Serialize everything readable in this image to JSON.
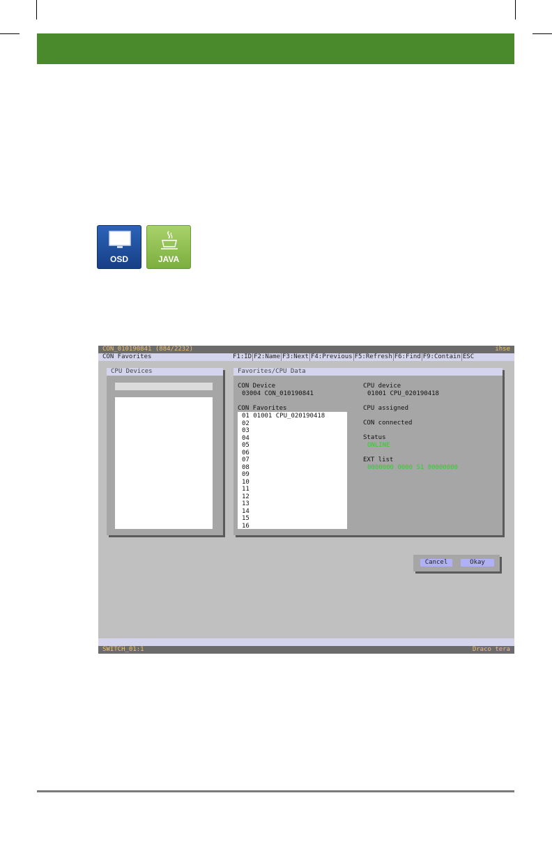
{
  "badges": {
    "osd": "OSD",
    "java": "JAVA"
  },
  "osd": {
    "title": "CON_010190841 (884/2232)",
    "brand": "ihse",
    "menu_title": "CON Favorites",
    "fkeys": [
      "F1:ID",
      "F2:Name",
      "F3:Next",
      "F4:Previous",
      "F5:Refresh",
      "F6:Find",
      "F9:Contain",
      "ESC"
    ],
    "cpu_panel": {
      "title": "CPU Devices"
    },
    "fav_panel": {
      "title": "Favorites/CPU Data",
      "con_device_label": "CON Device",
      "con_device_value": "03004 CON_010190841",
      "con_favorites_label": "CON Favorites",
      "favorites": [
        "01 01001 CPU_020190418",
        "02",
        "03",
        "04",
        "05",
        "06",
        "07",
        "08",
        "09",
        "10",
        "11",
        "12",
        "13",
        "14",
        "15",
        "16"
      ],
      "cpu_device_label": "CPU device",
      "cpu_device_value": "01001 CPU_020190418",
      "cpu_assigned_label": "CPU assigned",
      "con_connected_label": "CON connected",
      "status_label": "Status",
      "status_value": "ONLINE",
      "ext_list_label": "EXT list",
      "ext_list_value": "0000000 0000 S1 00000000"
    },
    "buttons": {
      "cancel": "Cancel",
      "okay": "Okay"
    },
    "status_left": "SWITCH_01:1",
    "status_right": "Draco tera"
  },
  "colors": {
    "header_green": "#4a8a2c",
    "status_green": "#2ad12a",
    "osd_blue": "#2c63b8",
    "java_green": "#8dbf4e"
  }
}
